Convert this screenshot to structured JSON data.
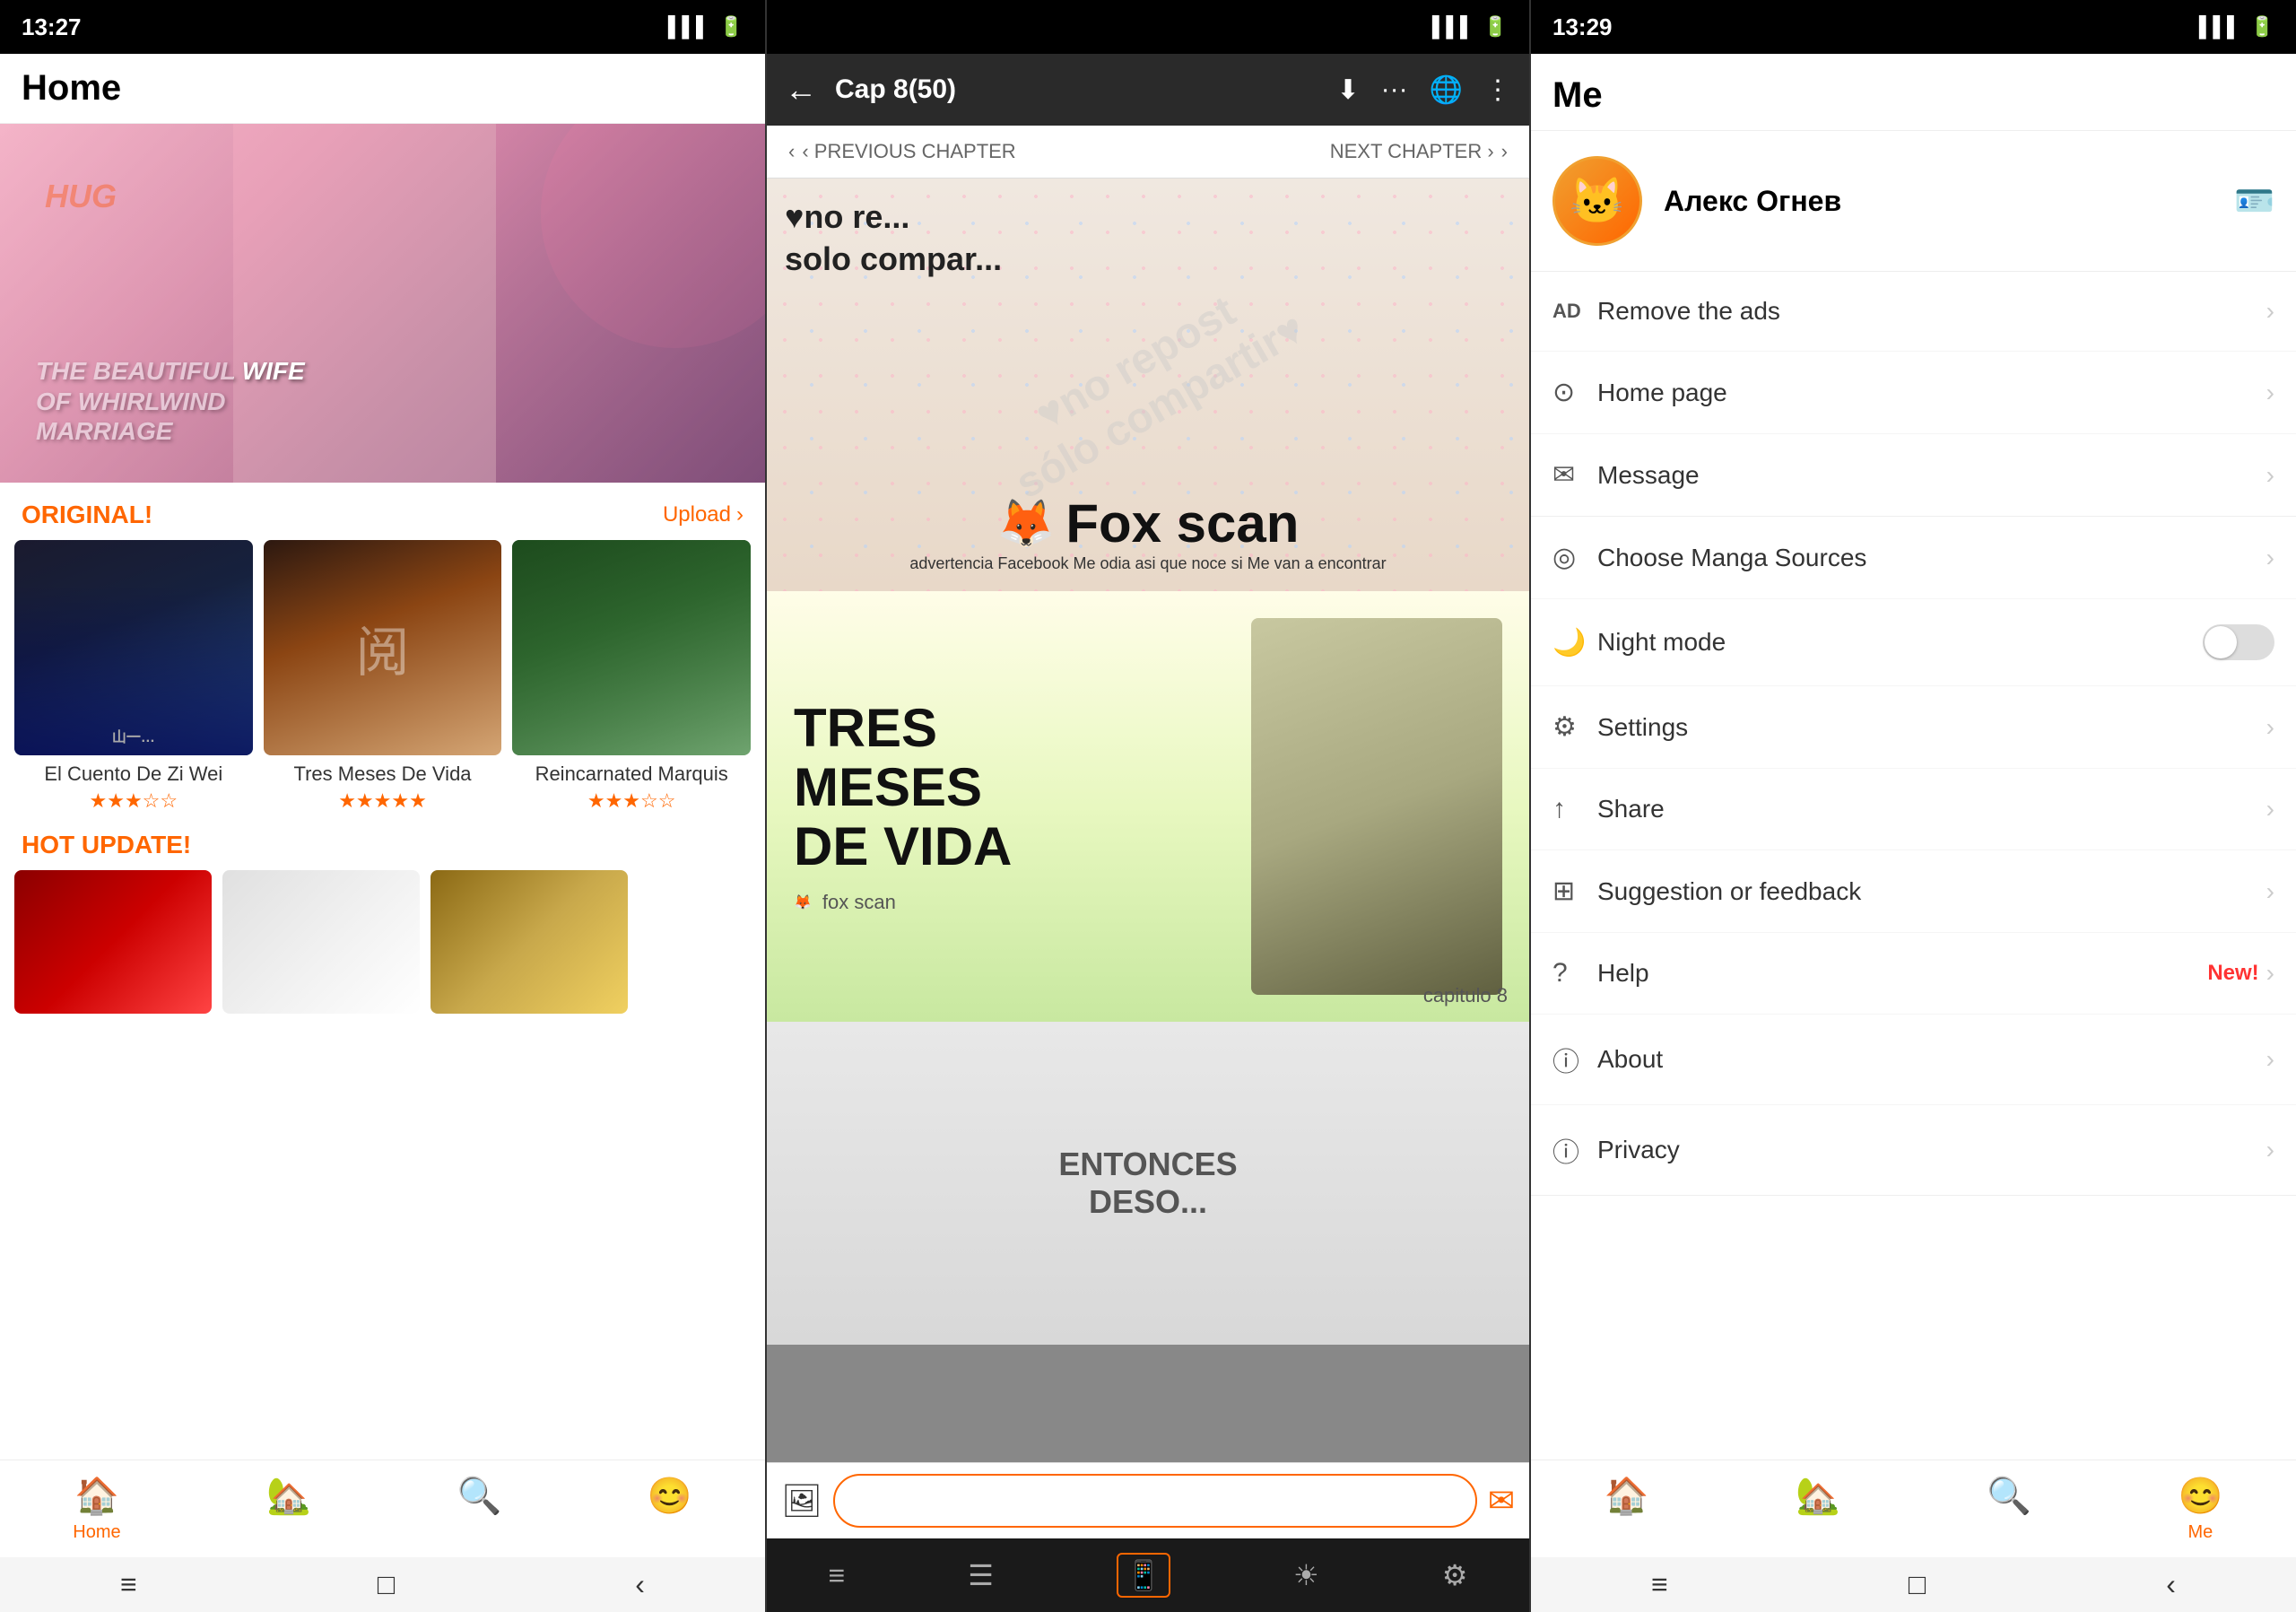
{
  "left": {
    "statusBar": {
      "time": "13:27",
      "batteryIcon": "🔋",
      "signalIcon": "📶",
      "wifiIcon": "🔋"
    },
    "title": "Home",
    "banner": {
      "hug": "HUG",
      "line1": "THE BEAUTIFUL WIFE",
      "line2": "OF WHIRLWIND",
      "line3": "MARRIAGE"
    },
    "sectionOriginal": "ORIGINAL!",
    "sectionUpload": "Upload",
    "mangas": [
      {
        "title": "El Cuento De Zi Wei",
        "stars": 3.5,
        "filledStars": 3,
        "halfStar": true,
        "emptyStars": 2
      },
      {
        "title": "Tres Meses De Vida",
        "stars": 5,
        "filledStars": 5,
        "halfStar": false,
        "emptyStars": 0
      },
      {
        "title": "Reincarnated Marquis",
        "stars": 3.5,
        "filledStars": 3,
        "halfStar": true,
        "emptyStars": 2
      }
    ],
    "sectionHot": "HOT UPDATE!",
    "bottomNav": [
      {
        "label": "Home",
        "icon": "🏠",
        "active": true
      },
      {
        "label": "",
        "icon": "🏡",
        "active": false
      },
      {
        "label": "",
        "icon": "🔍",
        "active": false
      },
      {
        "label": "",
        "icon": "😊",
        "active": false
      }
    ],
    "systemNav": [
      "≡",
      "□",
      "‹"
    ]
  },
  "middle": {
    "statusBar": {
      "time": "",
      "note": "dark status bar"
    },
    "header": {
      "back": "←",
      "chapter": "Cap 8(50)",
      "icons": [
        "⬇",
        "···",
        "🌐",
        "⋮"
      ]
    },
    "nav": {
      "prev": "‹ PREVIOUS CHAPTER",
      "next": "NEXT CHAPTER ›"
    },
    "pages": [
      {
        "textTop": "♥no re...\nsolo compar...",
        "watermark": "♥no repost\nsólo compartir♥",
        "foxScan": "Fox scan",
        "bottomText": "advertencia Facebook Me odia asi que noce si Me van a encontrar"
      },
      {
        "text1": "TRES",
        "text2": "MESES",
        "text3": "DE VIDA",
        "chapter": "capitulo 8"
      },
      {
        "text": "ENTONCES\nDESO..."
      }
    ],
    "bottomInput": {
      "placeholder": ""
    },
    "systemNav": {
      "items": [
        "≡",
        "☰",
        "📱",
        "☀",
        "⚙"
      ],
      "activeIndex": 2
    }
  },
  "right": {
    "statusBar": {
      "time": "13:29",
      "icons": "🔋"
    },
    "title": "Me",
    "profile": {
      "name": "Алекс Огнев",
      "avatar": "🐱"
    },
    "menu": [
      {
        "icon": "AD",
        "label": "Remove the ads",
        "type": "arrow",
        "iconClass": "ad"
      },
      {
        "icon": "⊙",
        "label": "Home page",
        "type": "arrow"
      },
      {
        "icon": "✉",
        "label": "Message",
        "type": "arrow"
      },
      {
        "icon": "◎",
        "label": "Choose Manga Sources",
        "type": "arrow"
      },
      {
        "icon": "🌙",
        "label": "Night mode",
        "type": "toggle"
      },
      {
        "icon": "⚙",
        "label": "Settings",
        "type": "arrow"
      },
      {
        "icon": "↑",
        "label": "Share",
        "type": "arrow"
      },
      {
        "icon": "⊞",
        "label": "Suggestion or feedback",
        "type": "arrow"
      },
      {
        "icon": "?",
        "label": "Help",
        "badge": "New!",
        "type": "arrow"
      },
      {
        "icon": "ⓘ",
        "label": "About",
        "type": "arrow"
      },
      {
        "icon": "ⓘ",
        "label": "Privacy",
        "type": "arrow"
      }
    ],
    "bottomNav": [
      {
        "label": "",
        "icon": "🏠",
        "active": false
      },
      {
        "label": "",
        "icon": "🏡",
        "active": false
      },
      {
        "label": "",
        "icon": "🔍",
        "active": false
      },
      {
        "label": "Me",
        "icon": "😊",
        "active": true
      }
    ],
    "systemNav": [
      "≡",
      "□",
      "‹"
    ]
  }
}
